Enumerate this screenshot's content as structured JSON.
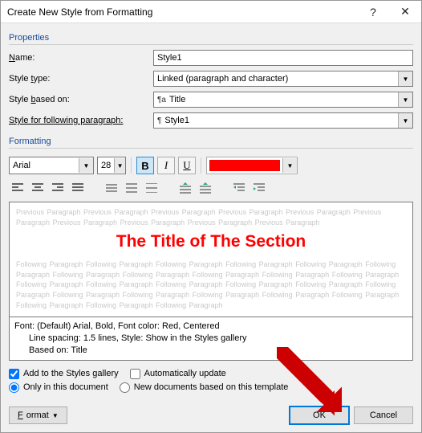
{
  "title": "Create New Style from Formatting",
  "sections": {
    "properties": "Properties",
    "formatting": "Formatting"
  },
  "fields": {
    "name": {
      "label_pre": "N",
      "label_post": "ame:",
      "value": "Style1"
    },
    "styleType": {
      "label_pre": "Style ",
      "label_u": "t",
      "label_post": "ype:",
      "value": "Linked (paragraph and character)"
    },
    "basedOn": {
      "label_pre": "Style ",
      "label_u": "b",
      "label_post": "ased on:",
      "value": "Title"
    },
    "following": {
      "label": "Style for following paragraph:",
      "value": "Style1"
    }
  },
  "toolbar": {
    "font": "Arial",
    "size": "28",
    "bold": "B",
    "italic": "I",
    "underline": "U",
    "colorHex": "#ff0000"
  },
  "preview": {
    "ghostBefore": "Previous Paragraph Previous Paragraph Previous Paragraph Previous Paragraph Previous Paragraph Previous Paragraph Previous Paragraph Previous Paragraph Previous Paragraph Previous Paragraph",
    "title": "The Title of The Section",
    "ghostAfter": "Following Paragraph Following Paragraph Following Paragraph Following Paragraph Following Paragraph Following Paragraph Following Paragraph Following Paragraph Following Paragraph Following Paragraph Following Paragraph Following Paragraph Following Paragraph Following Paragraph Following Paragraph Following Paragraph Following Paragraph Following Paragraph Following Paragraph Following Paragraph Following Paragraph Following Paragraph Following Paragraph Following Paragraph Following Paragraph"
  },
  "description": {
    "line1": "Font: (Default) Arial, Bold, Font color: Red, Centered",
    "line2": "Line spacing:  1.5 lines, Style: Show in the Styles gallery",
    "line3": "Based on: Title"
  },
  "options": {
    "addToGallery": "Add to the Styles gallery",
    "autoUpdate": "Automatically update",
    "onlyThisDoc": "Only in this document",
    "newDocs": "New documents based on this template"
  },
  "buttons": {
    "format": "Format",
    "ok": "OK",
    "cancel": "Cancel"
  }
}
